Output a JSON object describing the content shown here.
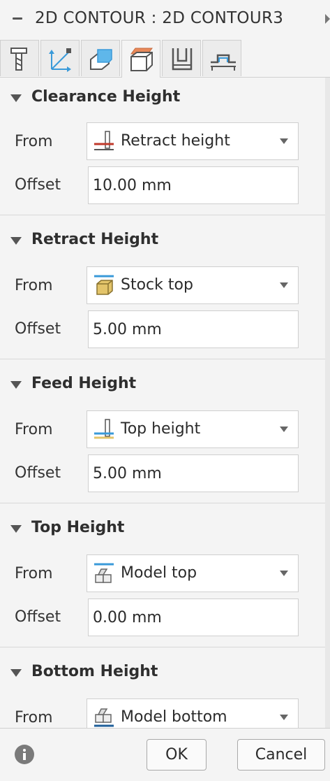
{
  "window": {
    "title": "2D CONTOUR : 2D CONTOUR3"
  },
  "tabs": [
    {
      "icon": "tool-icon",
      "active": false
    },
    {
      "icon": "geometry-icon",
      "active": false
    },
    {
      "icon": "heights-icon",
      "active": false
    },
    {
      "icon": "passes-icon",
      "active": true
    },
    {
      "icon": "linking-icon",
      "active": false
    },
    {
      "icon": "tabs-icon",
      "active": false
    }
  ],
  "sections": {
    "clearance": {
      "title": "Clearance Height",
      "from_label": "From",
      "from_value": "Retract height",
      "from_icon": "retract-height-icon",
      "offset_label": "Offset",
      "offset_value": "10.00 mm"
    },
    "retract": {
      "title": "Retract Height",
      "from_label": "From",
      "from_value": "Stock top",
      "from_icon": "stock-top-icon",
      "offset_label": "Offset",
      "offset_value": "5.00 mm"
    },
    "feed": {
      "title": "Feed Height",
      "from_label": "From",
      "from_value": "Top height",
      "from_icon": "top-height-icon",
      "offset_label": "Offset",
      "offset_value": "5.00 mm"
    },
    "top": {
      "title": "Top Height",
      "from_label": "From",
      "from_value": "Model top",
      "from_icon": "model-top-icon",
      "offset_label": "Offset",
      "offset_value": "0.00 mm"
    },
    "bottom": {
      "title": "Bottom Height",
      "from_label": "From",
      "from_value": "Model bottom",
      "from_icon": "model-bottom-icon"
    }
  },
  "footer": {
    "ok_label": "OK",
    "cancel_label": "Cancel"
  },
  "colors": {
    "accent_orange": "#e8895a",
    "accent_blue": "#3a9ad9",
    "stock_yellow": "#e3c46a",
    "retract_red": "#c0392b"
  }
}
